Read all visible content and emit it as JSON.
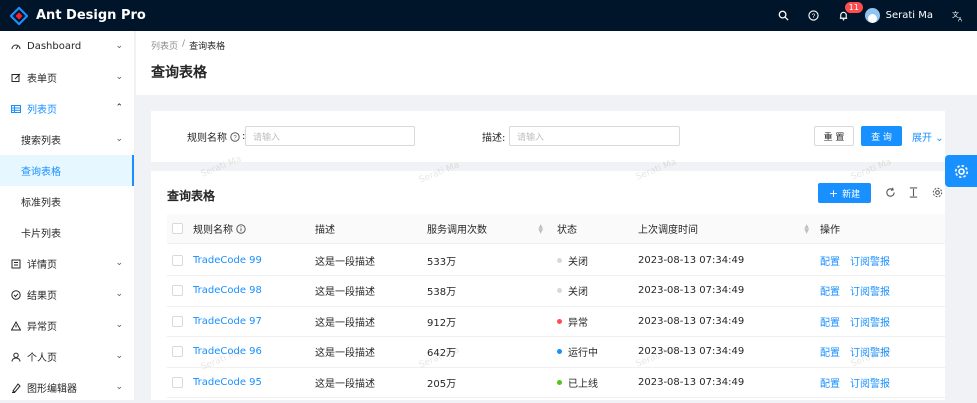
{
  "app": {
    "title": "Ant Design Pro"
  },
  "header": {
    "notification_count": "11",
    "user_name": "Serati Ma"
  },
  "sidebar": {
    "items": [
      {
        "label": "Dashboard"
      },
      {
        "label": "表单页"
      },
      {
        "label": "列表页"
      },
      {
        "label": "搜索列表"
      },
      {
        "label": "查询表格"
      },
      {
        "label": "标准列表"
      },
      {
        "label": "卡片列表"
      },
      {
        "label": "详情页"
      },
      {
        "label": "结果页"
      },
      {
        "label": "异常页"
      },
      {
        "label": "个人页"
      },
      {
        "label": "图形编辑器"
      }
    ]
  },
  "breadcrumb": {
    "parent": "列表页",
    "separator": "/",
    "current": "查询表格"
  },
  "page": {
    "title": "查询表格"
  },
  "search": {
    "rule_label": "规则名称",
    "rule_placeholder": "请输入",
    "desc_label": "描述:",
    "desc_placeholder": "请输入",
    "reset_label": "重 置",
    "query_label": "查 询",
    "expand_label": "展开"
  },
  "table": {
    "title": "查询表格",
    "new_label": "新建",
    "columns": [
      "规则名称",
      "描述",
      "服务调用次数",
      "状态",
      "上次调度时间",
      "操作"
    ],
    "rows": [
      {
        "name": "TradeCode 99",
        "desc": "这是一段描述",
        "calls": "533万",
        "status": "关闭",
        "status_color": "#d9d9d9",
        "time": "2023-08-13 07:34:49",
        "action1": "配置",
        "action2": "订阅警报"
      },
      {
        "name": "TradeCode 98",
        "desc": "这是一段描述",
        "calls": "538万",
        "status": "关闭",
        "status_color": "#d9d9d9",
        "time": "2023-08-13 07:34:49",
        "action1": "配置",
        "action2": "订阅警报"
      },
      {
        "name": "TradeCode 97",
        "desc": "这是一段描述",
        "calls": "912万",
        "status": "异常",
        "status_color": "#ff4d4f",
        "time": "2023-08-13 07:34:49",
        "action1": "配置",
        "action2": "订阅警报"
      },
      {
        "name": "TradeCode 96",
        "desc": "这是一段描述",
        "calls": "642万",
        "status": "运行中",
        "status_color": "#1890ff",
        "time": "2023-08-13 07:34:49",
        "action1": "配置",
        "action2": "订阅警报"
      },
      {
        "name": "TradeCode 95",
        "desc": "这是一段描述",
        "calls": "205万",
        "status": "已上线",
        "status_color": "#52c41a",
        "time": "2023-08-13 07:34:49",
        "action1": "配置",
        "action2": "订阅警报"
      }
    ]
  },
  "watermark": {
    "text": "Serati Ma"
  },
  "colors": {
    "header_bg": "#001529",
    "primary": "#1890ff",
    "bg": "#f0f2f5"
  },
  "icons": [
    "logo-icon",
    "search-icon",
    "question-icon",
    "bell-icon",
    "translate-icon",
    "dashboard-icon",
    "form-icon",
    "table-icon",
    "profile-icon",
    "check-circle-icon",
    "warning-icon",
    "user-icon",
    "highlight-icon",
    "info-circle-icon",
    "plus-icon",
    "reload-icon",
    "column-height-icon",
    "setting-icon",
    "chevron-down-icon",
    "chevron-up-icon"
  ]
}
